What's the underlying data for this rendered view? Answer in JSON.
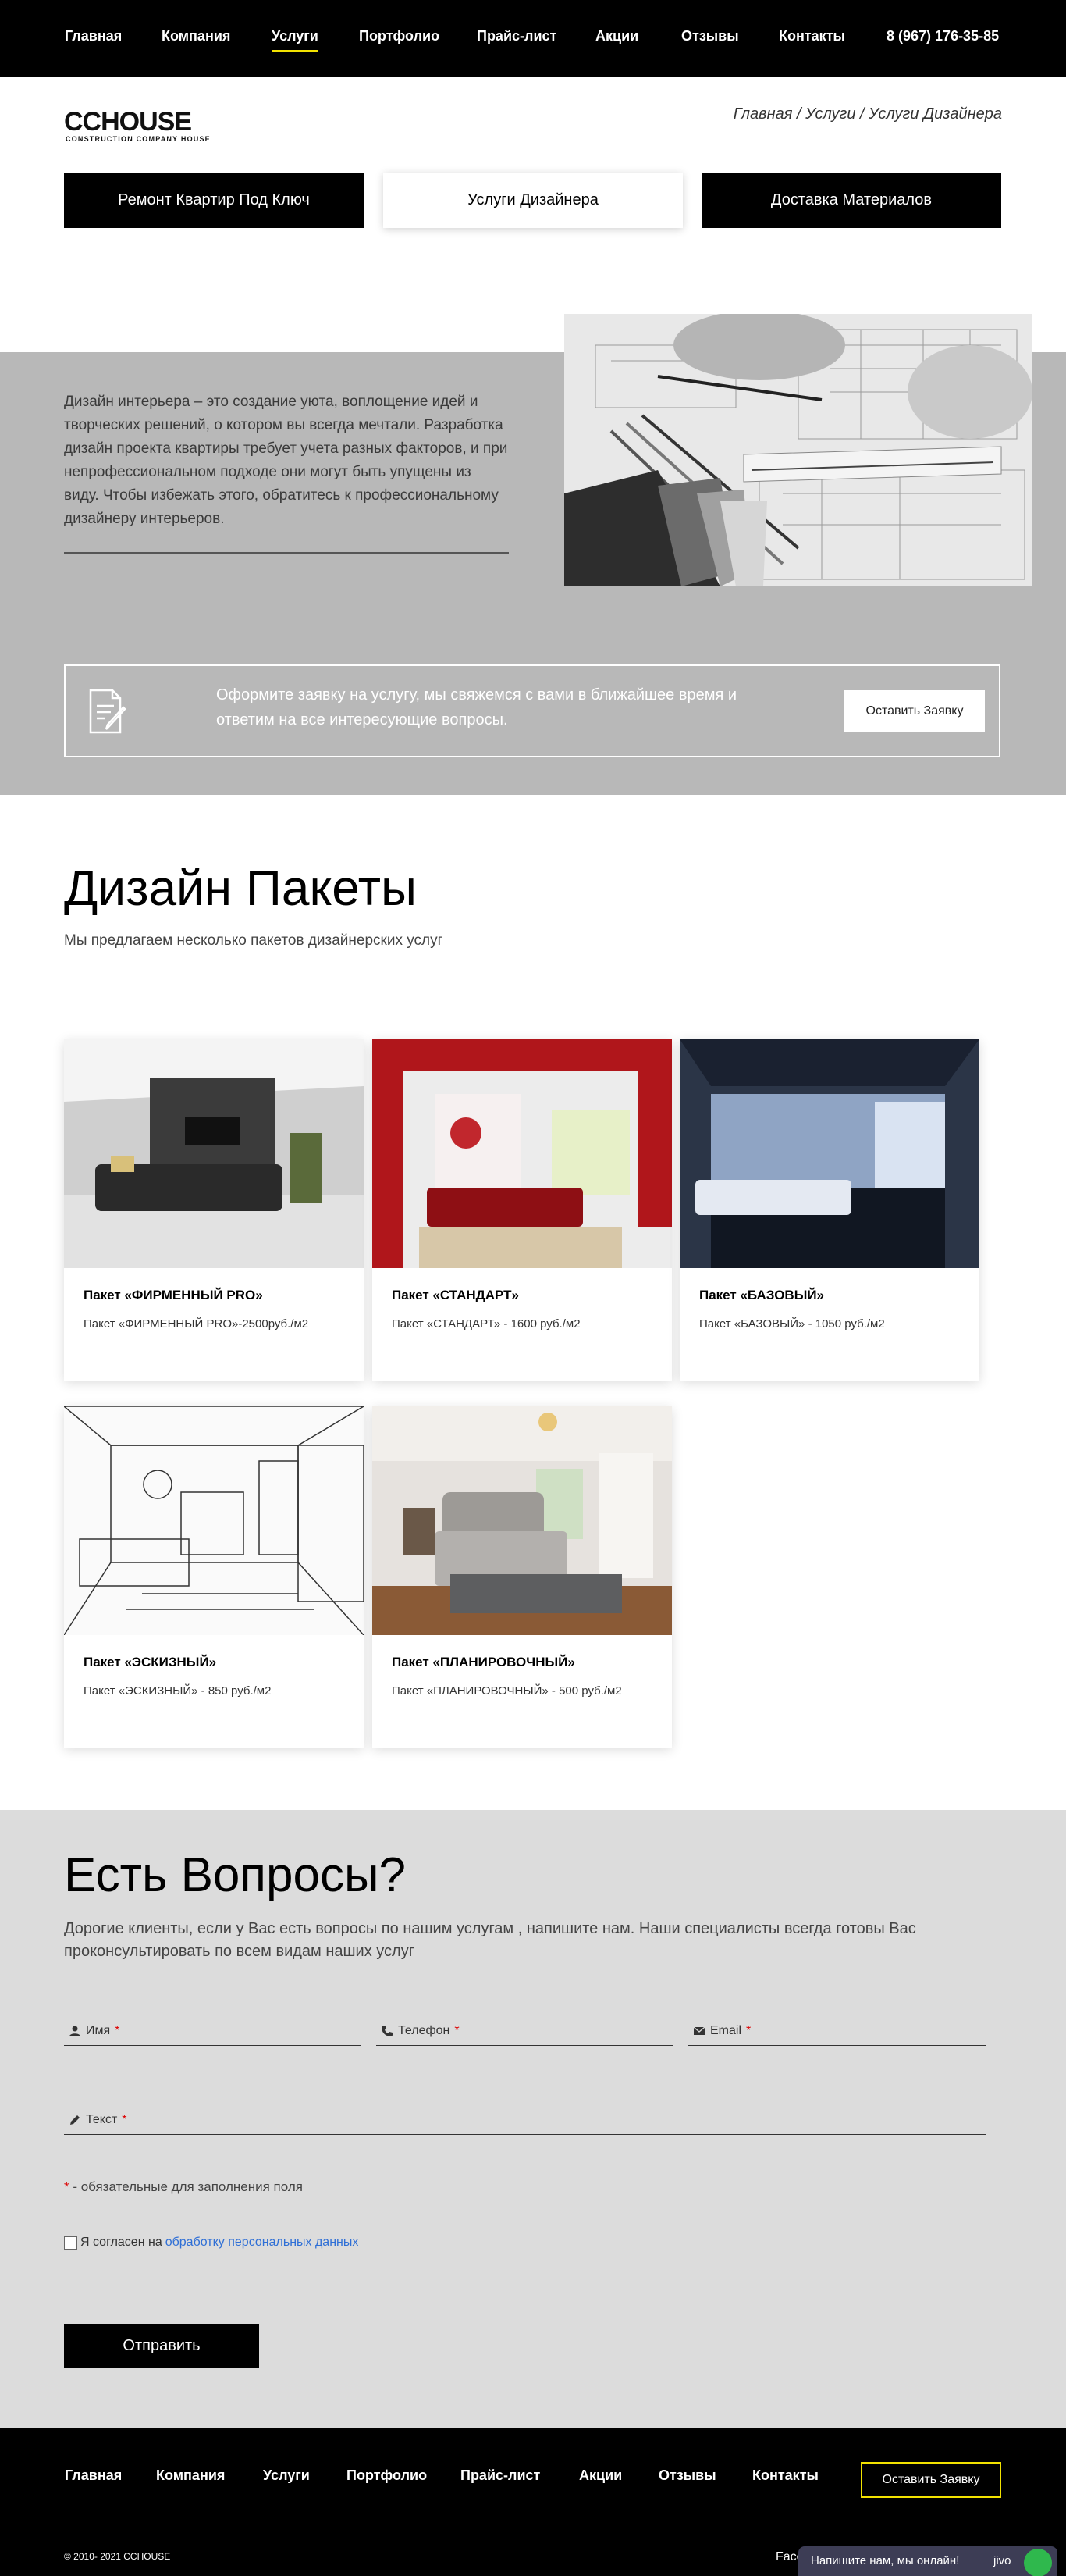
{
  "nav": {
    "items": [
      {
        "label": "Главная",
        "active": false
      },
      {
        "label": "Компания",
        "active": false
      },
      {
        "label": "Услуги",
        "active": true
      },
      {
        "label": "Портфолио",
        "active": false
      },
      {
        "label": "Прайс-лист",
        "active": false
      },
      {
        "label": "Акции",
        "active": false
      },
      {
        "label": "Отзывы",
        "active": false
      },
      {
        "label": "Контакты",
        "active": false
      }
    ],
    "phone": "8 (967) 176-35-85",
    "accent_color": "#f2e200"
  },
  "logo": {
    "brand": "CCHOUSE",
    "tagline": "CONSTRUCTION COMPANY HOUSE"
  },
  "breadcrumb": "Главная / Услуги / Услуги Дизайнера",
  "services": {
    "tabs": [
      {
        "label": "Ремонт Квартир Под Ключ",
        "active": false
      },
      {
        "label": "Услуги Дизайнера",
        "active": true
      },
      {
        "label": "Доставка Материалов",
        "active": false
      }
    ]
  },
  "intro": {
    "text": "Дизайн интерьера – это создание уюта, воплощение идей и творческих решений, о котором вы всегда мечтали. Разработка дизайн проекта квартиры требует учета разных факторов, и при непрофессиональном подходе они могут быть упущены из виду. Чтобы избежать этого, обратитесь к профессиональному дизайнеру интерьеров."
  },
  "cta": {
    "text": "Оформите заявку на услугу, мы свяжемся с вами в ближайшее время и ответим на все интересующие вопросы.",
    "button": "Оставить Заявку"
  },
  "packages": {
    "title": "Дизайн Пакеты",
    "subtitle": "Мы предлагаем несколько пакетов дизайнерских услуг",
    "items": [
      {
        "title": "Пакет «ФИРМЕННЫЙ PRO»",
        "desc": "Пакет «ФИРМЕННЫЙ PRO»-2500руб./м2"
      },
      {
        "title": "Пакет «СТАНДАРТ»",
        "desc": "Пакет «СТАНДАРТ» - 1600 руб./м2"
      },
      {
        "title": "Пакет «БАЗОВЫЙ»",
        "desc": "Пакет «БАЗОВЫЙ» - 1050 руб./м2"
      },
      {
        "title": "Пакет «ЭСКИЗНЫЙ»",
        "desc": "Пакет «ЭСКИЗНЫЙ» - 850 руб./м2"
      },
      {
        "title": "Пакет «ПЛАНИРОВОЧНЫЙ»",
        "desc": "Пакет «ПЛАНИРОВОЧНЫЙ» - 500 руб./м2"
      }
    ]
  },
  "form": {
    "title": "Есть Вопросы?",
    "description": "Дорогие клиенты, если у Вас есть вопросы по нашим услугам , напишите нам. Наши специалисты всегда готовы Вас проконсультировать по всем видам наших услуг",
    "fields": {
      "name": "Имя",
      "phone": "Телефон",
      "email": "Email",
      "text": "Текст"
    },
    "required_mark": "*",
    "required_note": " - обязательные для заполнения поля",
    "consent_prefix": "Я согласен на ",
    "consent_link": "обработку персональных данных",
    "submit": "Отправить"
  },
  "footer": {
    "nav": [
      "Главная",
      "Компания",
      "Услуги",
      "Портфолио",
      "Прайс-лист",
      "Акции",
      "Отзывы",
      "Контакты"
    ],
    "button": "Оставить Заявку",
    "copyright": "© 2010- 2021 CCHOUSE",
    "social": "Face"
  },
  "chat": {
    "text": "Напишите нам, мы онлайн!",
    "brand": "jivo"
  }
}
